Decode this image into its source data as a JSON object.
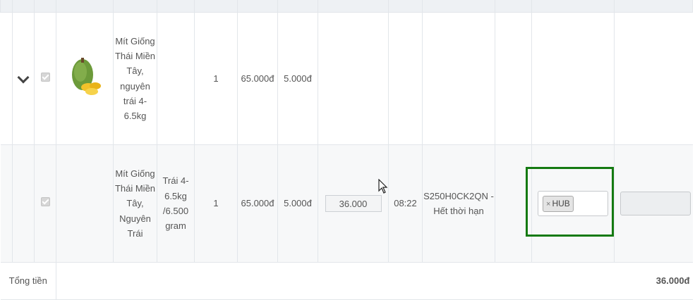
{
  "rows": [
    {
      "expand_icon": "chevron-down-icon",
      "product_image": "jackfruit-image",
      "name": "Mít Giống Thái Miền Tây, nguyên trái 4-6.5kg",
      "variant": "",
      "quantity": "1",
      "price": "65.000đ",
      "fee": "5.000đ"
    },
    {
      "name": "Mít Giống Thái Miền Tây, Nguyên Trái",
      "variant": "Trái 4-6.5kg /6.500 gram",
      "quantity": "1",
      "price": "65.000đ",
      "fee": "5.000đ",
      "amount_value": "36.000",
      "time": "08:22",
      "code_status": "S250H0CK2QN - Hết thời hạn",
      "tags": [
        "HUB"
      ],
      "tag_remove_glyph": "×"
    }
  ],
  "footer": {
    "label": "Tổng tiền",
    "total": "36.000đ"
  },
  "colors": {
    "highlight_border": "#157a12"
  }
}
